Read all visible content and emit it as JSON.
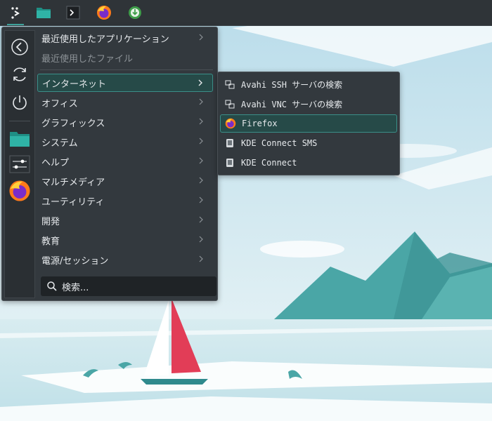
{
  "colors": {
    "panel": "#2f3438",
    "menu_bg": "#33393e",
    "highlight": "#264a48",
    "highlight_border": "#3b8f89",
    "accent": "#3fa7a0",
    "text": "#e6e9ec",
    "sail": "#e23d57"
  },
  "panel": {
    "items": [
      {
        "name": "application-launcher",
        "icon": "kde-launcher-icon",
        "active": true
      },
      {
        "name": "file-manager",
        "icon": "folder-icon"
      },
      {
        "name": "terminal",
        "icon": "terminal-icon"
      },
      {
        "name": "firefox",
        "icon": "firefox-icon"
      },
      {
        "name": "software-updater",
        "icon": "download-icon"
      }
    ]
  },
  "sidebar": {
    "icons": [
      "back-icon",
      "refresh-icon",
      "power-icon",
      "folder-icon",
      "settings-icon",
      "firefox-icon"
    ]
  },
  "menu": {
    "categories": [
      {
        "label": "最近使用したアプリケーション",
        "disabled": false
      },
      {
        "label": "最近使用したファイル",
        "disabled": true
      },
      {
        "label": "インターネット",
        "highlighted": true
      },
      {
        "label": "オフィス"
      },
      {
        "label": "グラフィックス"
      },
      {
        "label": "システム"
      },
      {
        "label": "ヘルプ"
      },
      {
        "label": "マルチメディア"
      },
      {
        "label": "ユーティリティ"
      },
      {
        "label": "開発"
      },
      {
        "label": "教育"
      },
      {
        "label": "電源/セッション"
      }
    ],
    "search_placeholder": "検索..."
  },
  "submenu": {
    "items": [
      {
        "label": "Avahi SSH サーバの検索",
        "icon": "network-icon"
      },
      {
        "label": "Avahi VNC サーバの検索",
        "icon": "network-icon"
      },
      {
        "label": "Firefox",
        "icon": "firefox-icon",
        "highlighted": true
      },
      {
        "label": "KDE Connect SMS",
        "icon": "kdeconnect-icon"
      },
      {
        "label": "KDE Connect",
        "icon": "kdeconnect-icon"
      }
    ]
  }
}
